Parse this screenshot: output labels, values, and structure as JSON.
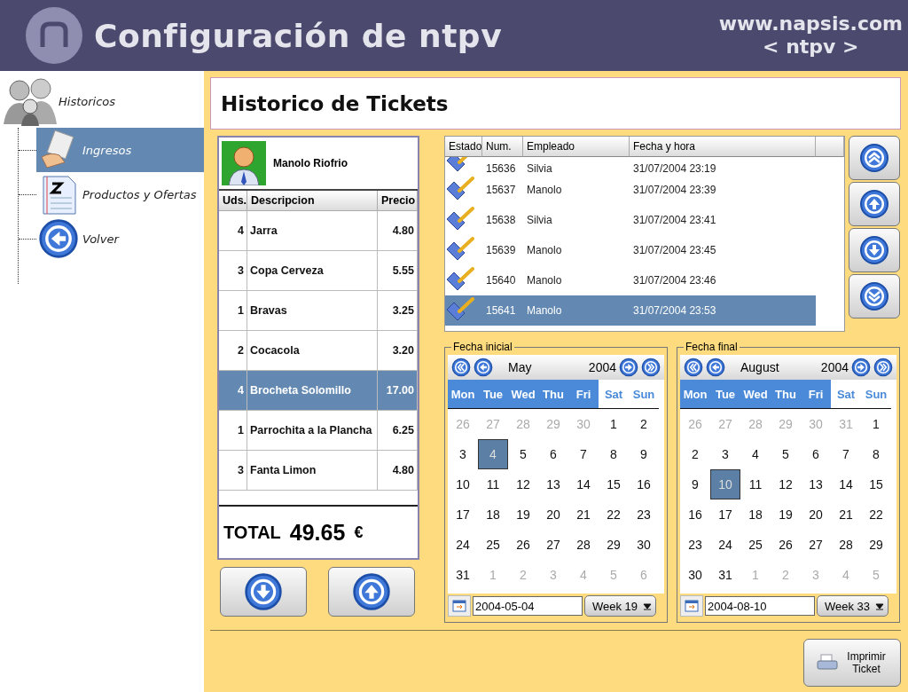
{
  "header": {
    "title": "Configuración de ntpv",
    "site": "www.napsis.com",
    "product": "< ntpv >"
  },
  "sidebar": {
    "root": "Historicos",
    "items": [
      {
        "label": "Ingresos",
        "kind": "receipt",
        "selected": true
      },
      {
        "label": "Productos y Ofertas",
        "kind": "list",
        "selected": false
      },
      {
        "label": "Volver",
        "kind": "back",
        "selected": false
      }
    ]
  },
  "page_title": "Historico de Tickets",
  "ticket": {
    "employee": "Manolo Riofrio",
    "columns": [
      "Uds.",
      "Descripcion",
      "Precio"
    ],
    "rows": [
      {
        "qty": "4",
        "description": "Jarra",
        "price": "4.80",
        "selected": false
      },
      {
        "qty": "3",
        "description": "Copa Cerveza",
        "price": "5.55",
        "selected": false
      },
      {
        "qty": "1",
        "description": "Bravas",
        "price": "3.25",
        "selected": false
      },
      {
        "qty": "2",
        "description": "Cocacola",
        "price": "3.20",
        "selected": false
      },
      {
        "qty": "4",
        "description": "Brocheta Solomillo",
        "price": "17.00",
        "selected": true
      },
      {
        "qty": "1",
        "description": "Parrochita a  la Plancha",
        "price": "6.25",
        "selected": false
      },
      {
        "qty": "3",
        "description": "Fanta Limon",
        "price": "4.80",
        "selected": false
      }
    ],
    "total_label": "TOTAL",
    "total": "49.65",
    "currency": "€"
  },
  "tickets": {
    "columns": [
      "Estado",
      "Num.",
      "Empleado",
      "Fecha y hora"
    ],
    "rows": [
      {
        "num": "15636",
        "employee": "Silvia",
        "datetime": "31/07/2004 23:19",
        "selected": false
      },
      {
        "num": "15637",
        "employee": "Manolo",
        "datetime": "31/07/2004 23:39",
        "selected": false
      },
      {
        "num": "15638",
        "employee": "Silvia",
        "datetime": "31/07/2004 23:41",
        "selected": false
      },
      {
        "num": "15639",
        "employee": "Manolo",
        "datetime": "31/07/2004 23:45",
        "selected": false
      },
      {
        "num": "15640",
        "employee": "Manolo",
        "datetime": "31/07/2004 23:46",
        "selected": false
      },
      {
        "num": "15641",
        "employee": "Manolo",
        "datetime": "31/07/2004 23:53",
        "selected": true
      }
    ]
  },
  "calendars": [
    {
      "legend": "Fecha inicial",
      "month": "May",
      "year": "2004",
      "date": "2004-05-04",
      "week": "Week 19",
      "weekdays": [
        {
          "label": "Mon",
          "weekend": false
        },
        {
          "label": "Tue",
          "weekend": false
        },
        {
          "label": "Wed",
          "weekend": false
        },
        {
          "label": "Thu",
          "weekend": false
        },
        {
          "label": "Fri",
          "weekend": false
        },
        {
          "label": "Sat",
          "weekend": true
        },
        {
          "label": "Sun",
          "weekend": true
        }
      ],
      "days": [
        {
          "d": "26",
          "muted": true,
          "selected": false
        },
        {
          "d": "27",
          "muted": true,
          "selected": false
        },
        {
          "d": "28",
          "muted": true,
          "selected": false
        },
        {
          "d": "29",
          "muted": true,
          "selected": false
        },
        {
          "d": "30",
          "muted": true,
          "selected": false
        },
        {
          "d": "1",
          "muted": false,
          "selected": false
        },
        {
          "d": "2",
          "muted": false,
          "selected": false
        },
        {
          "d": "3",
          "muted": false,
          "selected": false
        },
        {
          "d": "4",
          "muted": false,
          "selected": true
        },
        {
          "d": "5",
          "muted": false,
          "selected": false
        },
        {
          "d": "6",
          "muted": false,
          "selected": false
        },
        {
          "d": "7",
          "muted": false,
          "selected": false
        },
        {
          "d": "8",
          "muted": false,
          "selected": false
        },
        {
          "d": "9",
          "muted": false,
          "selected": false
        },
        {
          "d": "10",
          "muted": false,
          "selected": false
        },
        {
          "d": "11",
          "muted": false,
          "selected": false
        },
        {
          "d": "12",
          "muted": false,
          "selected": false
        },
        {
          "d": "13",
          "muted": false,
          "selected": false
        },
        {
          "d": "14",
          "muted": false,
          "selected": false
        },
        {
          "d": "15",
          "muted": false,
          "selected": false
        },
        {
          "d": "16",
          "muted": false,
          "selected": false
        },
        {
          "d": "17",
          "muted": false,
          "selected": false
        },
        {
          "d": "18",
          "muted": false,
          "selected": false
        },
        {
          "d": "19",
          "muted": false,
          "selected": false
        },
        {
          "d": "20",
          "muted": false,
          "selected": false
        },
        {
          "d": "21",
          "muted": false,
          "selected": false
        },
        {
          "d": "22",
          "muted": false,
          "selected": false
        },
        {
          "d": "23",
          "muted": false,
          "selected": false
        },
        {
          "d": "24",
          "muted": false,
          "selected": false
        },
        {
          "d": "25",
          "muted": false,
          "selected": false
        },
        {
          "d": "26",
          "muted": false,
          "selected": false
        },
        {
          "d": "27",
          "muted": false,
          "selected": false
        },
        {
          "d": "28",
          "muted": false,
          "selected": false
        },
        {
          "d": "29",
          "muted": false,
          "selected": false
        },
        {
          "d": "30",
          "muted": false,
          "selected": false
        },
        {
          "d": "31",
          "muted": false,
          "selected": false
        },
        {
          "d": "1",
          "muted": true,
          "selected": false
        },
        {
          "d": "2",
          "muted": true,
          "selected": false
        },
        {
          "d": "3",
          "muted": true,
          "selected": false
        },
        {
          "d": "4",
          "muted": true,
          "selected": false
        },
        {
          "d": "5",
          "muted": true,
          "selected": false
        },
        {
          "d": "6",
          "muted": true,
          "selected": false
        }
      ]
    },
    {
      "legend": "Fecha final",
      "month": "August",
      "year": "2004",
      "date": "2004-08-10",
      "week": "Week 33",
      "weekdays": [
        {
          "label": "Mon",
          "weekend": false
        },
        {
          "label": "Tue",
          "weekend": false
        },
        {
          "label": "Wed",
          "weekend": false
        },
        {
          "label": "Thu",
          "weekend": false
        },
        {
          "label": "Fri",
          "weekend": false
        },
        {
          "label": "Sat",
          "weekend": true
        },
        {
          "label": "Sun",
          "weekend": true
        }
      ],
      "days": [
        {
          "d": "26",
          "muted": true,
          "selected": false
        },
        {
          "d": "27",
          "muted": true,
          "selected": false
        },
        {
          "d": "28",
          "muted": true,
          "selected": false
        },
        {
          "d": "29",
          "muted": true,
          "selected": false
        },
        {
          "d": "30",
          "muted": true,
          "selected": false
        },
        {
          "d": "31",
          "muted": true,
          "selected": false
        },
        {
          "d": "1",
          "muted": false,
          "selected": false
        },
        {
          "d": "2",
          "muted": false,
          "selected": false
        },
        {
          "d": "3",
          "muted": false,
          "selected": false
        },
        {
          "d": "4",
          "muted": false,
          "selected": false
        },
        {
          "d": "5",
          "muted": false,
          "selected": false
        },
        {
          "d": "6",
          "muted": false,
          "selected": false
        },
        {
          "d": "7",
          "muted": false,
          "selected": false
        },
        {
          "d": "8",
          "muted": false,
          "selected": false
        },
        {
          "d": "9",
          "muted": false,
          "selected": false
        },
        {
          "d": "10",
          "muted": false,
          "selected": true
        },
        {
          "d": "11",
          "muted": false,
          "selected": false
        },
        {
          "d": "12",
          "muted": false,
          "selected": false
        },
        {
          "d": "13",
          "muted": false,
          "selected": false
        },
        {
          "d": "14",
          "muted": false,
          "selected": false
        },
        {
          "d": "15",
          "muted": false,
          "selected": false
        },
        {
          "d": "16",
          "muted": false,
          "selected": false
        },
        {
          "d": "17",
          "muted": false,
          "selected": false
        },
        {
          "d": "18",
          "muted": false,
          "selected": false
        },
        {
          "d": "19",
          "muted": false,
          "selected": false
        },
        {
          "d": "20",
          "muted": false,
          "selected": false
        },
        {
          "d": "21",
          "muted": false,
          "selected": false
        },
        {
          "d": "22",
          "muted": false,
          "selected": false
        },
        {
          "d": "23",
          "muted": false,
          "selected": false
        },
        {
          "d": "24",
          "muted": false,
          "selected": false
        },
        {
          "d": "25",
          "muted": false,
          "selected": false
        },
        {
          "d": "26",
          "muted": false,
          "selected": false
        },
        {
          "d": "27",
          "muted": false,
          "selected": false
        },
        {
          "d": "28",
          "muted": false,
          "selected": false
        },
        {
          "d": "29",
          "muted": false,
          "selected": false
        },
        {
          "d": "30",
          "muted": false,
          "selected": false
        },
        {
          "d": "31",
          "muted": false,
          "selected": false
        },
        {
          "d": "1",
          "muted": true,
          "selected": false
        },
        {
          "d": "2",
          "muted": true,
          "selected": false
        },
        {
          "d": "3",
          "muted": true,
          "selected": false
        },
        {
          "d": "4",
          "muted": true,
          "selected": false
        },
        {
          "d": "5",
          "muted": true,
          "selected": false
        }
      ]
    }
  ],
  "print_button": "Imprimir Ticket"
}
